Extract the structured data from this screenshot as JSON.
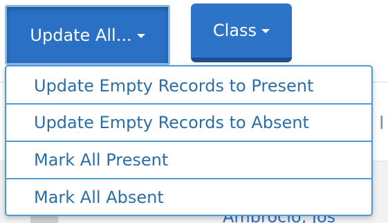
{
  "toolbar": {
    "update_all_label": "Update All...",
    "class_label": "Class"
  },
  "update_all_menu": {
    "items": [
      {
        "label": "Update Empty Records to Present"
      },
      {
        "label": "Update Empty Records to Absent"
      },
      {
        "label": "Mark All Present"
      },
      {
        "label": "Mark All Absent"
      }
    ]
  },
  "background": {
    "peek_text": "I",
    "partial_link_text": "Ambrocio, Jos"
  },
  "colors": {
    "button_primary": "#2d74c8",
    "menu_text": "#2a6ea8",
    "menu_border": "#4a9bd8"
  },
  "icons": {
    "button_caret": "chevron-down-icon"
  }
}
